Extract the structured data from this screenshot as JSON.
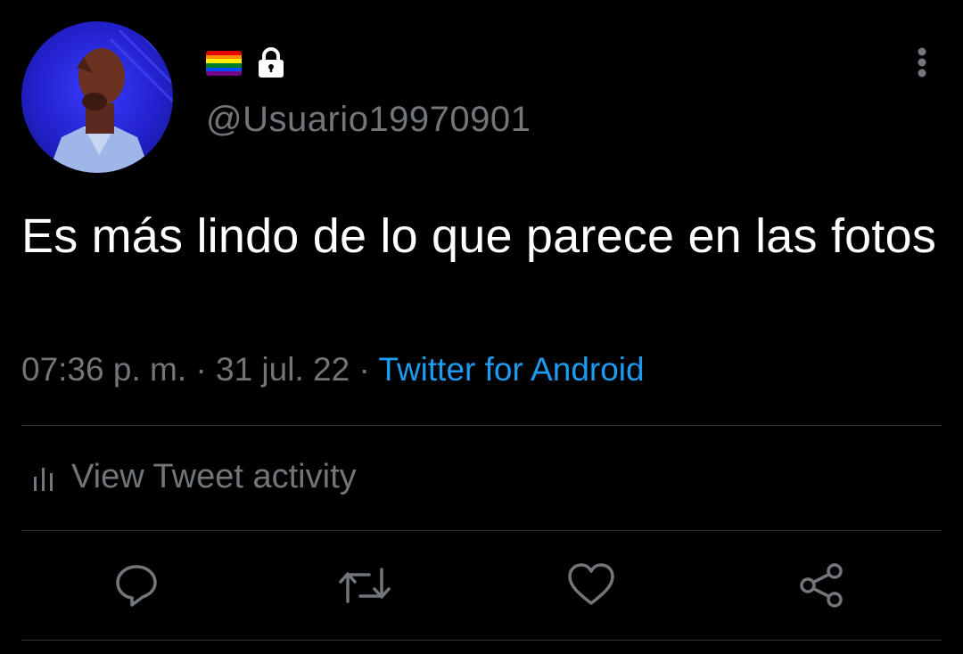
{
  "header": {
    "avatar_alt": "profile picture",
    "handle": "@Usuario19970901",
    "flag_colors": [
      "#e40303",
      "#ff8c00",
      "#ffed00",
      "#008026",
      "#004dff",
      "#750787"
    ]
  },
  "tweet": {
    "text": "Es más lindo de lo que parece en las fotos",
    "time": "07:36 p. m.",
    "separator": "·",
    "date": "31 jul. 22",
    "source": "Twitter for Android"
  },
  "activity": {
    "label": "View Tweet activity"
  },
  "actions": {
    "icons": [
      "reply-icon",
      "retweet-icon",
      "like-icon",
      "share-icon"
    ]
  },
  "colors": {
    "background": "#000000",
    "text": "#ffffff",
    "muted": "#71767b",
    "accent": "#1d9bf0",
    "divider": "#2f3336"
  }
}
